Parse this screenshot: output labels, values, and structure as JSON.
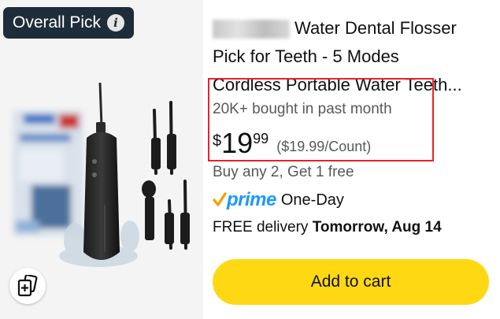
{
  "badge": {
    "label": "Overall Pick",
    "icon": "info-icon"
  },
  "product": {
    "brand_obscured": true,
    "title_line1_rest": "Water Dental Flosser",
    "title_line2": "Pick for Teeth - 5 Modes",
    "title_line3": "Cordless Portable Water Teeth...",
    "bought": "20K+ bought in past month",
    "price": {
      "symbol": "$",
      "whole": "19",
      "fraction": "99",
      "unit": "($19.99/Count)"
    },
    "offer": "Buy any 2, Get 1 free",
    "prime": {
      "logo_text": "prime",
      "speed": "One-Day"
    },
    "delivery": {
      "prefix": "FREE delivery ",
      "date": "Tomorrow, Aug 14"
    },
    "add_to_cart": "Add to cart"
  },
  "colors": {
    "badge_bg": "#1f2d3a",
    "highlight_border": "#e8222a",
    "button_bg": "#ffd814",
    "prime_blue": "#1a98ff",
    "prime_check": "#f0a500"
  }
}
